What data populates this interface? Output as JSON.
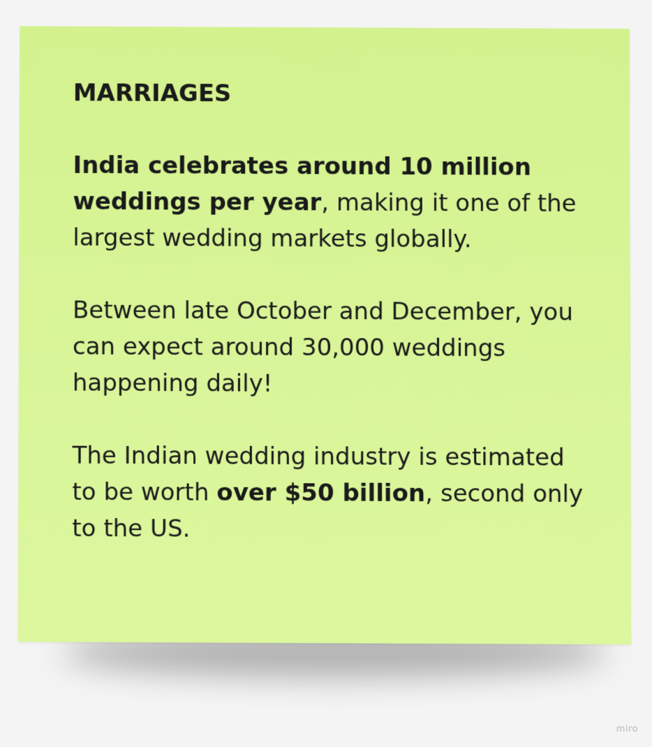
{
  "note": {
    "heading": "MARRIAGES",
    "p1": {
      "bold": "India celebrates around 10 million weddings per year",
      "rest": ", making it one of the largest wedding markets globally."
    },
    "p2": {
      "text": "Between late October and December, you can expect around 30,000 weddings happening daily!"
    },
    "p3": {
      "before": "The Indian wedding industry is estimated to be worth ",
      "bold": "over $50 billion",
      "after": ", second only to the US."
    },
    "background_color": "#d7f496",
    "text_color": "#1a1a1a"
  },
  "watermark": "miro"
}
